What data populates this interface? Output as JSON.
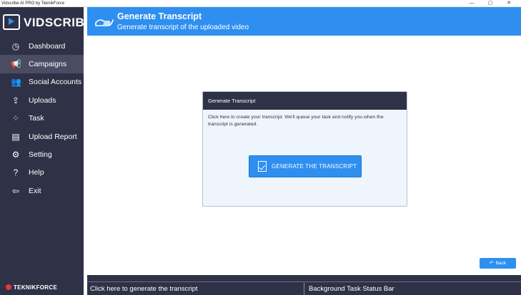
{
  "window": {
    "title": "Vidscribe AI PRO by TeknikForce",
    "min_glyph": "—",
    "max_glyph": "▢",
    "close_glyph": "✕"
  },
  "logo": {
    "text": "VIDSCRIBE"
  },
  "sidebar": {
    "items": [
      {
        "label": "Dashboard",
        "icon": "dashboard-icon",
        "glyph": "◷",
        "active": false
      },
      {
        "label": "Campaigns",
        "icon": "megaphone-icon",
        "glyph": "📢",
        "active": true
      },
      {
        "label": "Social Accounts",
        "icon": "users-icon",
        "glyph": "👥",
        "active": false
      },
      {
        "label": "Uploads",
        "icon": "upload-icon",
        "glyph": "⇪",
        "active": false
      },
      {
        "label": "Task",
        "icon": "spinner-icon",
        "glyph": "⁘",
        "active": false
      },
      {
        "label": "Upload Report",
        "icon": "report-icon",
        "glyph": "▤",
        "active": false
      },
      {
        "label": "Setting",
        "icon": "gear-icon",
        "glyph": "⚙",
        "active": false
      },
      {
        "label": "Help",
        "icon": "help-icon",
        "glyph": "?",
        "active": false
      },
      {
        "label": "Exit",
        "icon": "exit-icon",
        "glyph": "⇦",
        "active": false
      }
    ],
    "brand": "TEKNIKFORCE"
  },
  "header": {
    "title": "Generate Transcript",
    "subtitle": "Generate transcript of the uploaded video"
  },
  "card": {
    "title": "Generate Transcript",
    "body": "Click here to create your transcript. We'll queue your task and notify you when the transcript is generated.",
    "button_label": "GENERATE THE TRANSCRIPT"
  },
  "back_button": {
    "label": "Back",
    "arrow": "↶"
  },
  "statusbar": {
    "left": "Click here to generate the transcript",
    "right": "Background Task Status Bar"
  },
  "colors": {
    "sidebar_bg": "#2f3147",
    "accent": "#2f8ff0",
    "active_item": "#4a4c63",
    "card_bg": "#eef5fc"
  }
}
